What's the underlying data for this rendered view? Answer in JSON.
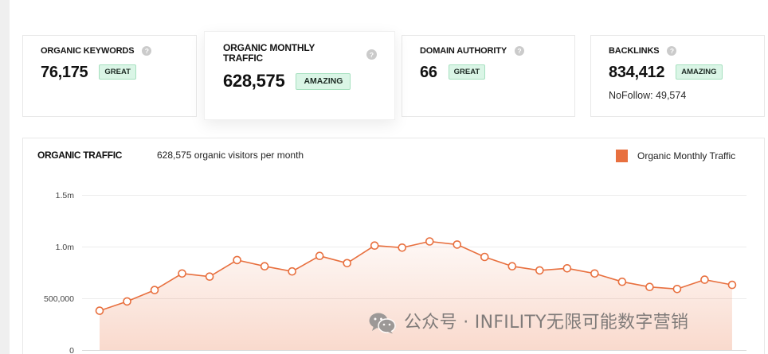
{
  "icons": {
    "help": "help-icon"
  },
  "colors": {
    "accent": "#e8703f",
    "badge_bg": "#daf5e6",
    "badge_border": "#a6e0bf",
    "help_icon": "#cbcbcb"
  },
  "metrics": [
    {
      "label": "ORGANIC KEYWORDS",
      "value": "76,175",
      "badge": "GREAT"
    },
    {
      "label": "ORGANIC MONTHLY TRAFFIC",
      "value": "628,575",
      "badge": "AMAZING"
    },
    {
      "label": "DOMAIN AUTHORITY",
      "value": "66",
      "badge": "GREAT"
    },
    {
      "label": "BACKLINKS",
      "value": "834,412",
      "badge": "AMAZING",
      "note": "NoFollow: 49,574"
    }
  ],
  "chart_data": {
    "type": "area",
    "title": "ORGANIC TRAFFIC",
    "subtitle": "628,575 organic visitors per month",
    "legend": "top-right",
    "grid": true,
    "ylim": [
      0,
      1500000
    ],
    "y_ticks": [
      {
        "value": 1500000,
        "label": "1.5m"
      },
      {
        "value": 1000000,
        "label": "1.0m"
      },
      {
        "value": 500000,
        "label": "500,000"
      },
      {
        "value": 0,
        "label": "0"
      }
    ],
    "series": [
      {
        "name": "Organic Monthly Traffic",
        "color": "#e8703f",
        "values": [
          380000,
          470000,
          580000,
          740000,
          710000,
          870000,
          810000,
          760000,
          910000,
          840000,
          1010000,
          990000,
          1050000,
          1020000,
          900000,
          810000,
          770000,
          790000,
          740000,
          660000,
          610000,
          590000,
          680000,
          630000
        ]
      }
    ]
  },
  "watermark": {
    "icon": "wechat-icon",
    "text": "公众号 · INFILITY无限可能数字营销"
  }
}
